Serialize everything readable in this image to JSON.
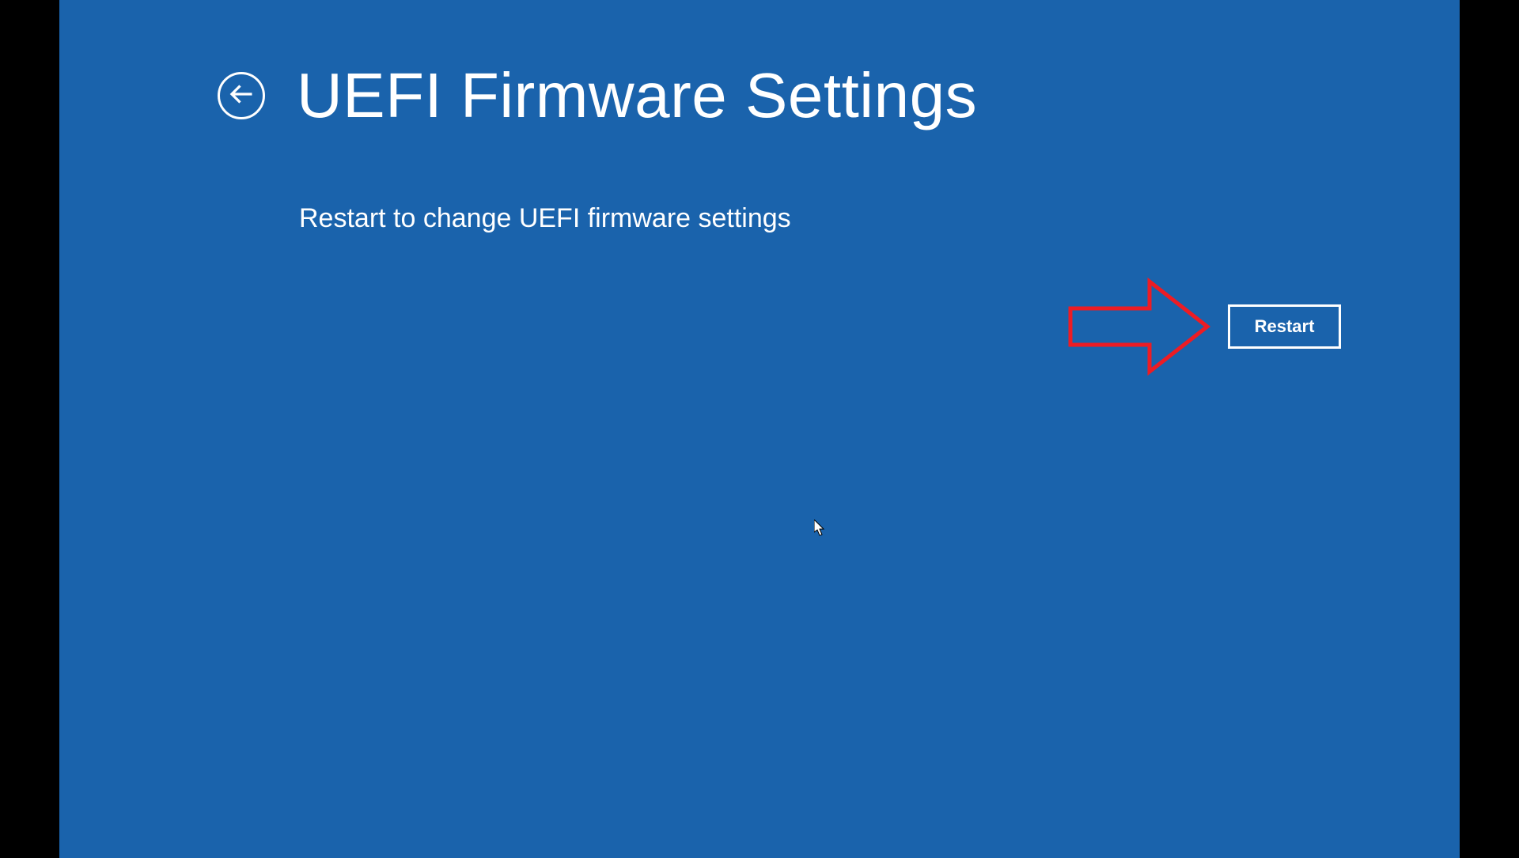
{
  "header": {
    "title": "UEFI Firmware Settings"
  },
  "body": {
    "subtitle": "Restart to change UEFI firmware settings"
  },
  "actions": {
    "restart_label": "Restart"
  },
  "colors": {
    "background": "#1a63ac",
    "text": "#ffffff",
    "letterbox": "#000000",
    "annotation": "#ed1c24"
  }
}
